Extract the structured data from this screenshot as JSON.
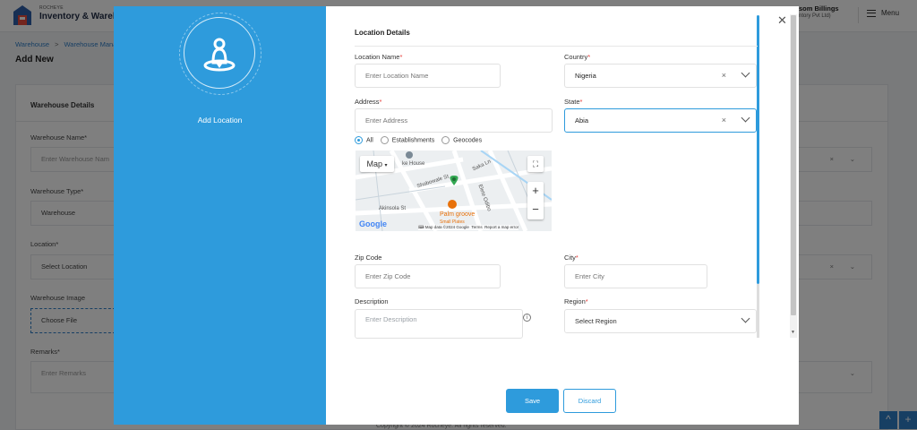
{
  "background": {
    "brand_small": "ROCHEYE",
    "brand_big": "Inventory & Wareho",
    "user_name": "som Billings",
    "user_company": "ntory Pvt Ltd)",
    "menu_label": "Menu",
    "breadcrumb": [
      "Warehouse",
      "Warehouse Mana"
    ],
    "page_title": "Add New",
    "card_title": "Warehouse Details",
    "fields": [
      {
        "label": "Warehouse Name*",
        "value": "Enter Warehouse Nam"
      },
      {
        "label": "Warehouse Type*",
        "value": "Warehouse"
      },
      {
        "label": "Location*",
        "value": "Select Location"
      },
      {
        "label": "Warehouse Image",
        "value": "Choose File"
      },
      {
        "label": "Remarks*",
        "value": "Enter Remarks"
      }
    ],
    "footer_text": "Copyright © 2024 Rocheye. All rights reserved."
  },
  "modal": {
    "left_title": "Add Location",
    "section_title": "Location Details",
    "location_name": {
      "label": "Location Name",
      "placeholder": "Enter Location Name"
    },
    "country": {
      "label": "Country",
      "value": "Nigeria"
    },
    "address": {
      "label": "Address",
      "placeholder": "Enter Address"
    },
    "state": {
      "label": "State",
      "value": "Abia"
    },
    "radio_options": [
      "All",
      "Establishments",
      "Geocodes"
    ],
    "radio_selected": "All",
    "map": {
      "type_label": "Map",
      "labels": [
        "ke House",
        "Saka Ln",
        "Shobowale St",
        "Akinsola St",
        "Palm groove",
        "Small Plates",
        "Elete Odibo"
      ],
      "attribution": "Map data ©2024 Google",
      "terms": "Terms",
      "report": "Report a map error",
      "google_text": "Google"
    },
    "zip": {
      "label": "Zip Code",
      "placeholder": "Enter Zip Code"
    },
    "city": {
      "label": "City",
      "placeholder": "Enter City"
    },
    "description": {
      "label": "Description",
      "placeholder": "Enter Description"
    },
    "region": {
      "label": "Region",
      "placeholder": "Select Region"
    },
    "save_label": "Save",
    "discard_label": "Discard",
    "accent_color": "#2e9bdc",
    "required_color": "#e53935"
  }
}
